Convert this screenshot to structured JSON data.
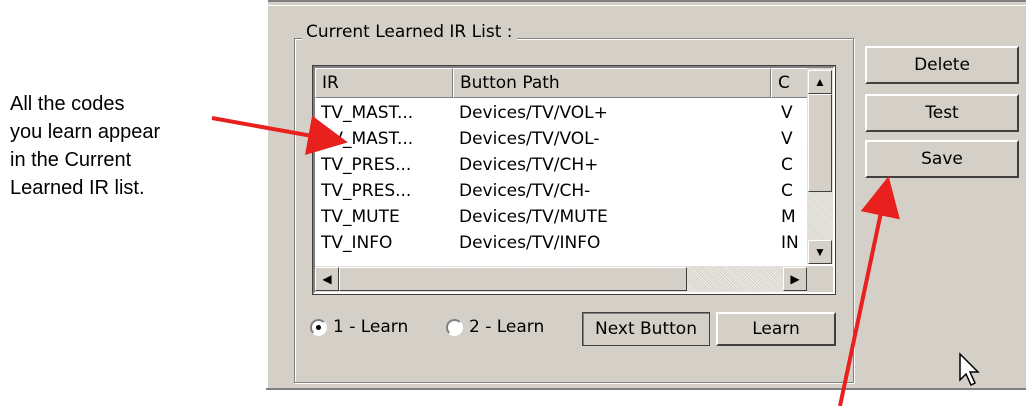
{
  "callout": {
    "lines": [
      "All the codes",
      "you learn appear",
      "in the Current",
      "Learned IR list."
    ]
  },
  "groupbox": {
    "title": "Current Learned IR List :"
  },
  "list": {
    "columns": [
      "IR",
      "Button Path",
      "C"
    ],
    "rows": [
      [
        "TV_MAST...",
        "Devices/TV/VOL+",
        "V"
      ],
      [
        "TV_MAST...",
        "Devices/TV/VOL-",
        "V"
      ],
      [
        "TV_PRES...",
        "Devices/TV/CH+",
        "C"
      ],
      [
        "TV_PRES...",
        "Devices/TV/CH-",
        "C"
      ],
      [
        "TV_MUTE",
        "Devices/TV/MUTE",
        "M"
      ],
      [
        "TV_INFO",
        "Devices/TV/INFO",
        "IN"
      ]
    ]
  },
  "radios": {
    "learn1": "1 - Learn",
    "learn2": "2 - Learn",
    "selected": "1 - Learn"
  },
  "buttons": {
    "next": "Next Button",
    "learn": "Learn",
    "delete": "Delete",
    "test": "Test",
    "save": "Save"
  },
  "colors": {
    "arrow": "#e8201e",
    "window": "#d4d0c8"
  }
}
